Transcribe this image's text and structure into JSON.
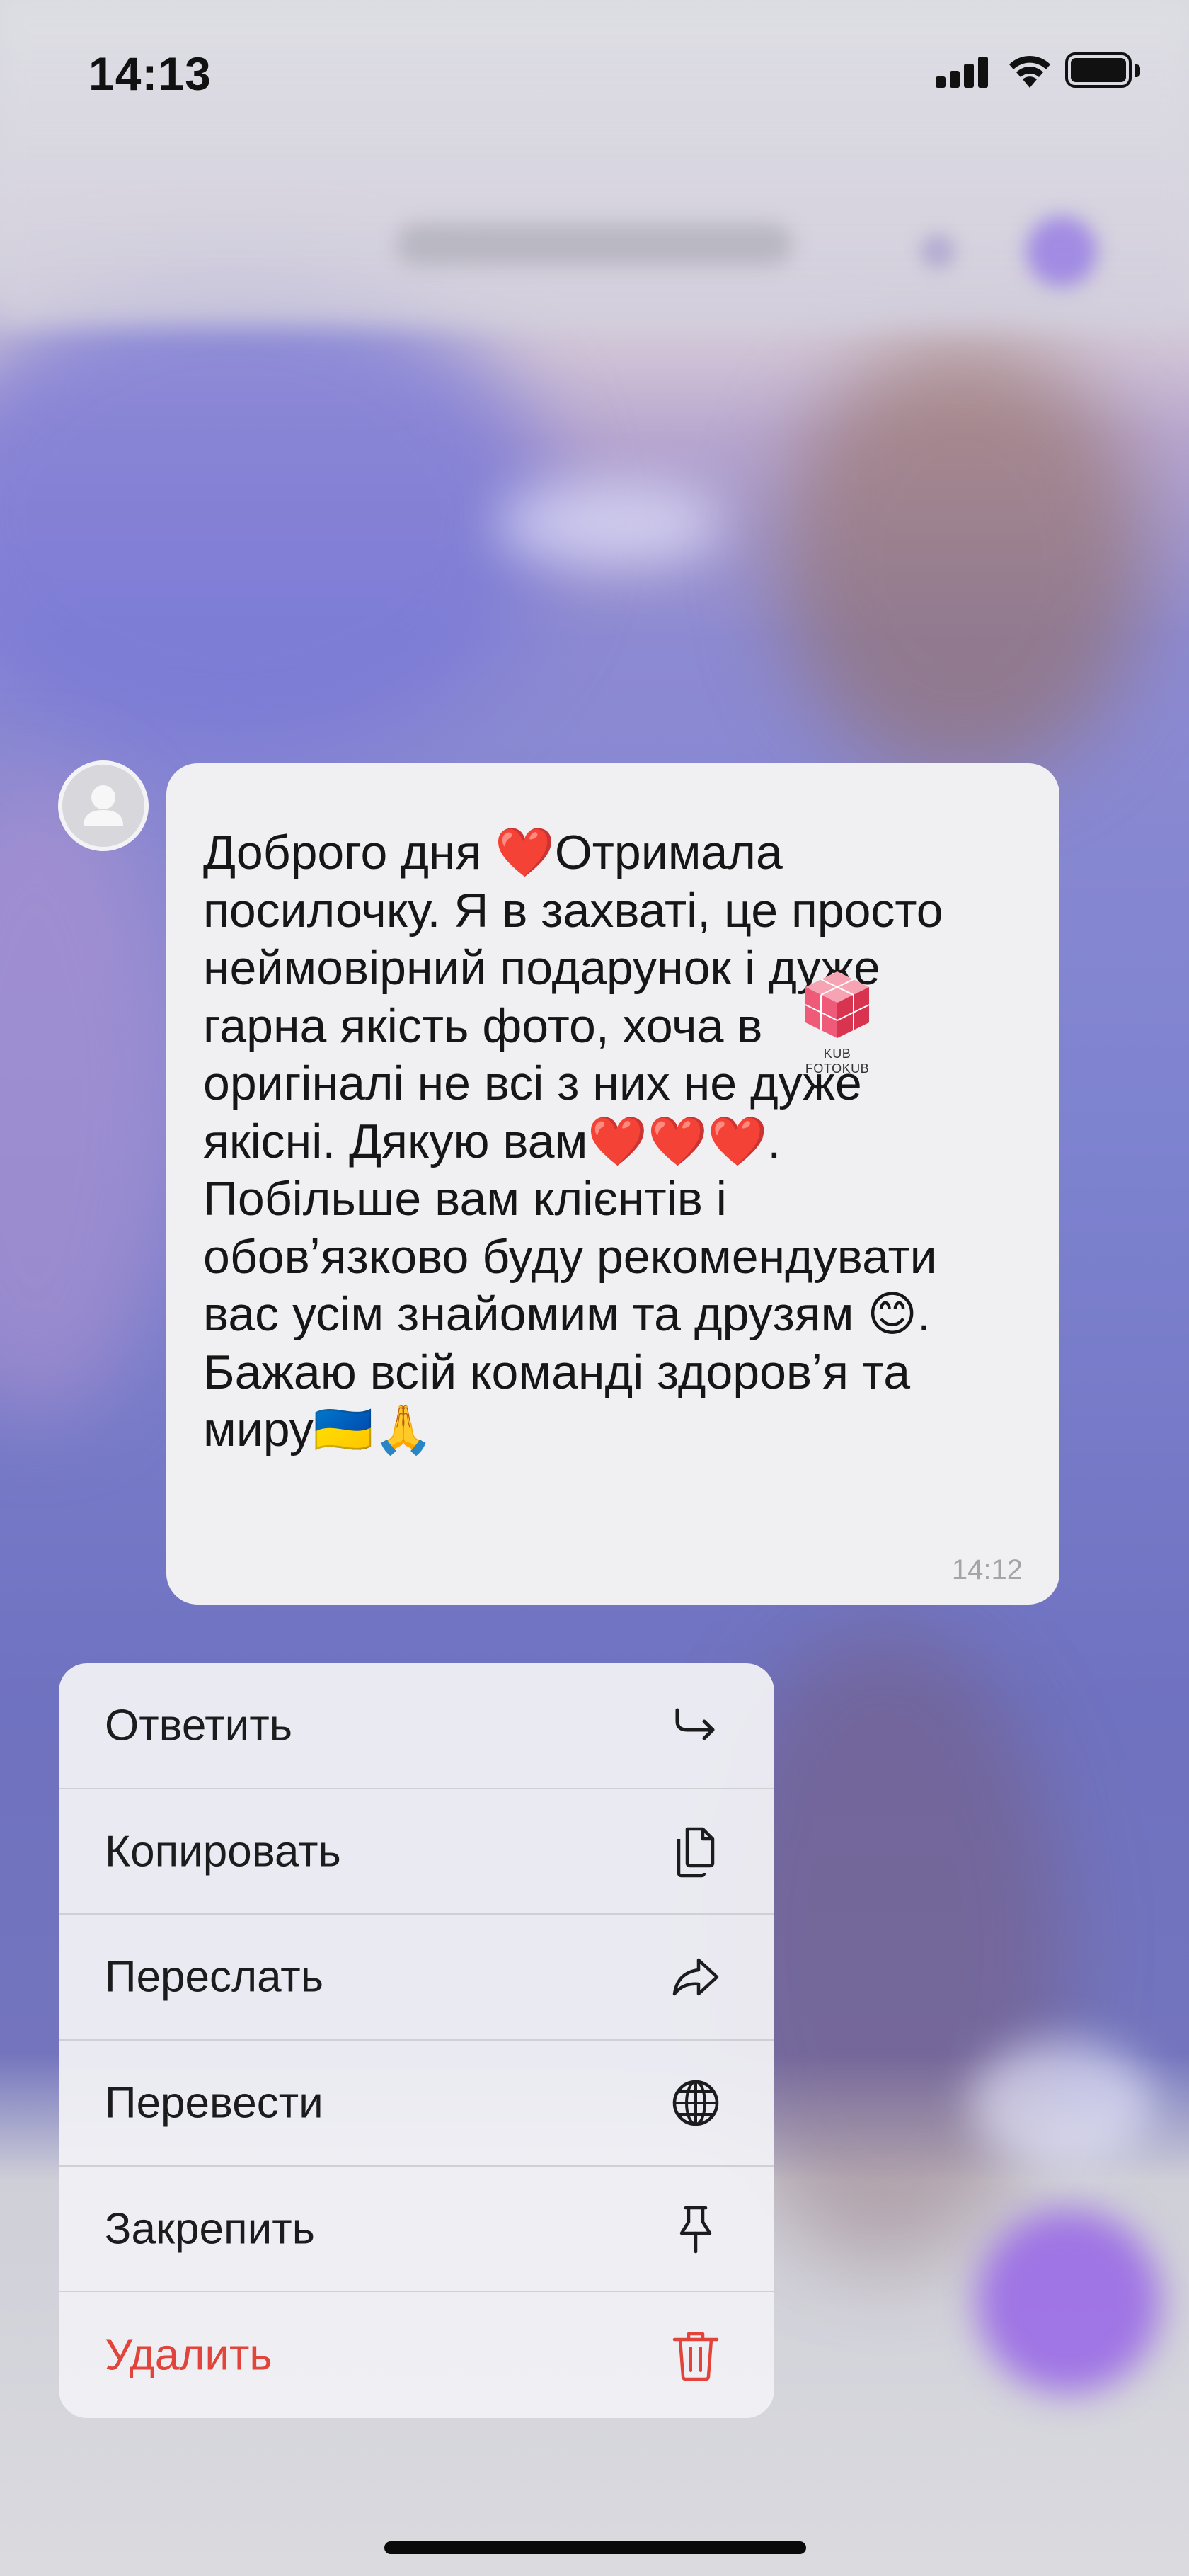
{
  "status_bar": {
    "time": "14:13"
  },
  "message": {
    "text": "Доброго дня ❤️Отримала\nпосилочку. Я в захваті, це просто\nнеймовірний подарунок і дуже\nгарна якість фото, хоча в\nоригіналі не всі з них не дуже\nякісні. Дякую вам❤️❤️❤️.\nПобільше вам клієнтів і\nобовʼязково буду рекомендувати\nвас усім знайомим та друзям 😊.\nБажаю всій команді здоровʼя та\nмиру🇺🇦🙏",
    "time": "14:12"
  },
  "watermark": {
    "text": "KUB FOTOKUB"
  },
  "context_menu": {
    "items": [
      {
        "label": "Ответить",
        "icon": "reply-icon"
      },
      {
        "label": "Копировать",
        "icon": "copy-icon"
      },
      {
        "label": "Переслать",
        "icon": "forward-icon"
      },
      {
        "label": "Перевести",
        "icon": "globe-icon"
      },
      {
        "label": "Закрепить",
        "icon": "pin-icon"
      },
      {
        "label": "Удалить",
        "icon": "trash-icon"
      }
    ]
  },
  "colors": {
    "danger": "#e0443a",
    "bubble": "#f0f0f2",
    "menu_background": "#f0f0f4"
  }
}
